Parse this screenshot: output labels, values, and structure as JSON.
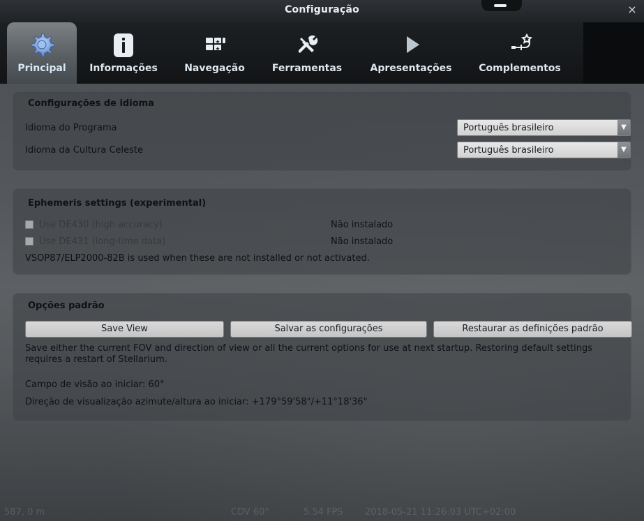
{
  "window": {
    "title": "Configuração",
    "close_glyph": "×"
  },
  "tabs": [
    {
      "label": "Principal",
      "icon": "gear-icon",
      "active": true
    },
    {
      "label": "Informações",
      "icon": "info-icon",
      "active": false
    },
    {
      "label": "Navegação",
      "icon": "grid-icon",
      "active": false
    },
    {
      "label": "Ferramentas",
      "icon": "tools-icon",
      "active": false
    },
    {
      "label": "Apresentações",
      "icon": "play-icon",
      "active": false
    },
    {
      "label": "Complementos",
      "icon": "plugin-icon",
      "active": false
    }
  ],
  "language_panel": {
    "title": "Configurações de idioma",
    "program_language_label": "Idioma do Programa",
    "program_language_value": "Português brasileiro",
    "sky_culture_language_label": "Idioma da Cultura Celeste",
    "sky_culture_language_value": "Português brasileiro"
  },
  "ephemeris_panel": {
    "title": "Ephemeris settings (experimental)",
    "de430_label": "Use DE430 (high accuracy)",
    "de430_status": "Não instalado",
    "de431_label": "Use DE431 (long-time data)",
    "de431_status": "Não instalado",
    "note": "VSOP87/ELP2000-82B is used when these are not installed or not activated."
  },
  "defaults_panel": {
    "title": "Opções padrão",
    "buttons": {
      "save_view": "Save View",
      "save_settings": "Salvar as configurações",
      "restore_defaults": "Restaurar as definições padrão"
    },
    "description": "Save either the current FOV and direction of view or all the current options for use at next startup. Restoring default settings requires a restart of Stellarium.",
    "fov_line": "Campo de visão ao iniciar: 60°",
    "direction_line": "Direção de visualização azimute/altura ao iniciar: +179°59'58\"/+11°18'36\""
  },
  "statusbar": {
    "altitude": "587, 0 m",
    "fov": "CDV 60°",
    "fps": "5.54 FPS",
    "datetime": "2018-05-21 11:26:03 UTC+02:00"
  },
  "colors": {
    "accent": "#d9e7f6"
  }
}
